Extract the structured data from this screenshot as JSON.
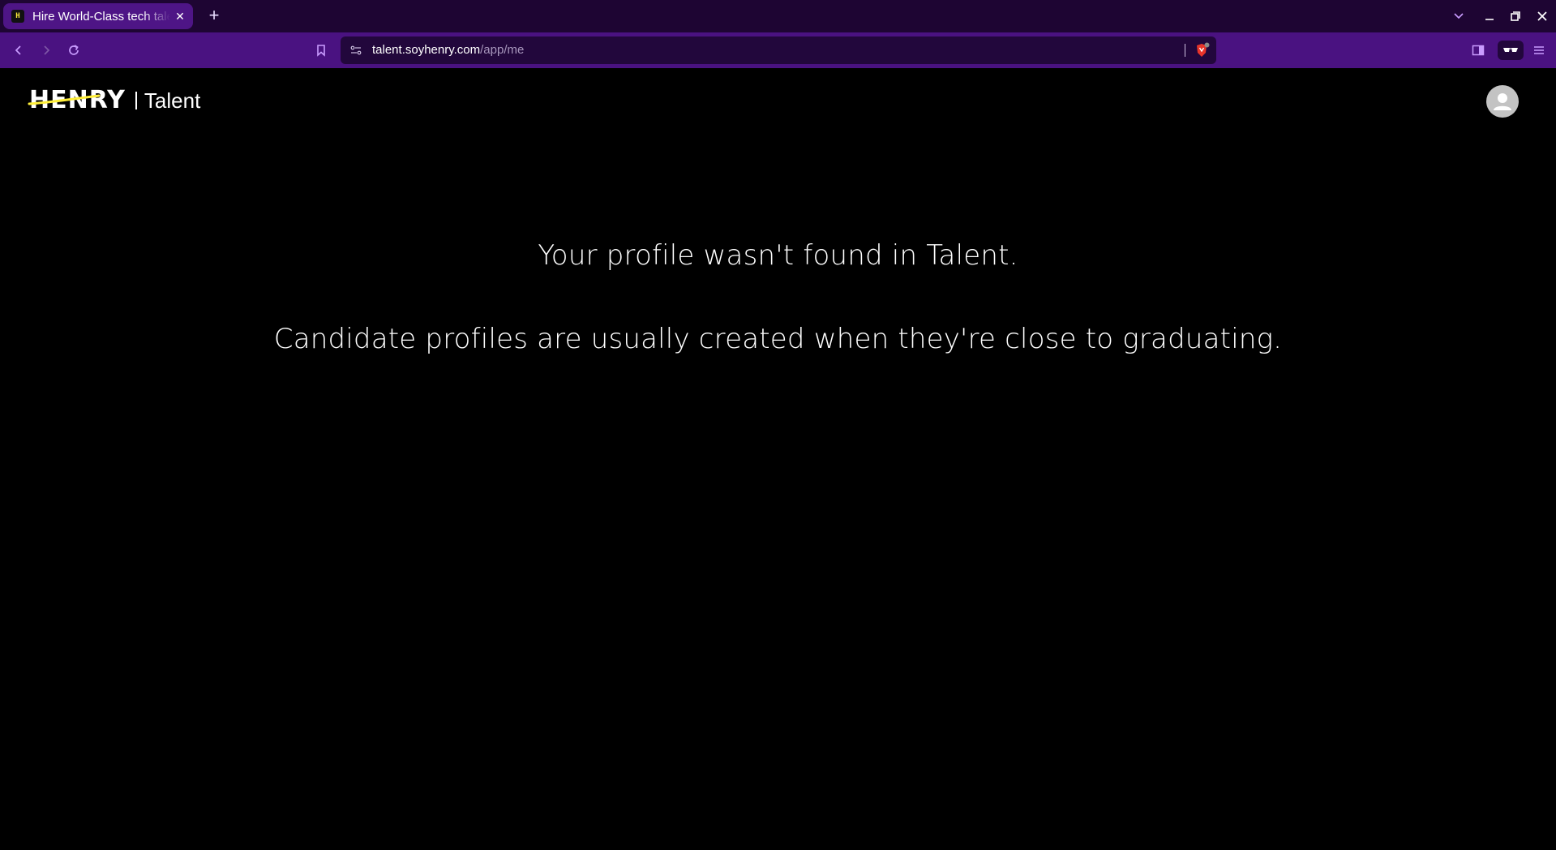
{
  "browser": {
    "tab": {
      "title": "Hire World-Class tech talent",
      "favicon_text": "H",
      "close_glyph": "✕"
    },
    "new_tab_glyph": "+",
    "url": {
      "host": "talent.soyhenry.com",
      "path": "/app/me"
    },
    "icons": [
      "back-icon",
      "forward-icon",
      "reload-icon",
      "bookmark-icon",
      "site-info-icon",
      "brave-shields-icon",
      "sidebar-icon",
      "leo-glasses-icon",
      "menu-icon",
      "tab-list-icon",
      "minimize-icon",
      "restore-icon",
      "close-icon"
    ],
    "colors": {
      "titlebar": "#1e0533",
      "tab_active": "#4e1586",
      "toolbar": "#4a1281",
      "urlbar": "#22073c"
    }
  },
  "page": {
    "logo": {
      "brand": "HENRY",
      "product": "Talent",
      "accent_color": "#ffef3a"
    },
    "avatar_icon": "user-avatar-icon",
    "message_line1": "Your profile wasn't found in Talent.",
    "message_line2": "Candidate profiles are usually created when they're close to graduating."
  }
}
